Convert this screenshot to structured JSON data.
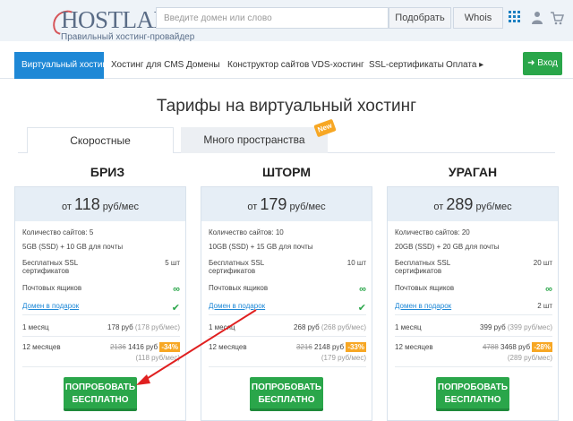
{
  "header": {
    "logo": "HOSTLAND",
    "tagline": "Правильный хостинг-провайдер",
    "search_placeholder": "Введите домен или слово",
    "find_label": "Подобрать",
    "whois_label": "Whois"
  },
  "nav": {
    "items": [
      {
        "label": "Виртуальный хостинг"
      },
      {
        "label": "Хостинг для CMS"
      },
      {
        "label": "Домены"
      },
      {
        "label": "Конструктор сайтов"
      },
      {
        "label": "VDS-хостинг"
      },
      {
        "label": "SSL-сертификаты"
      },
      {
        "label": "Оплата"
      }
    ],
    "login_label": "Вход"
  },
  "page": {
    "title": "Тарифы на виртуальный хостинг",
    "tabs": [
      {
        "label": "Скоростные"
      },
      {
        "label": "Много пространства"
      }
    ],
    "new_badge": "New"
  },
  "plans": [
    {
      "name": "БРИЗ",
      "price_prefix": "от",
      "price": "118",
      "price_unit": "руб/мес",
      "sites_label": "Количество сайтов:",
      "sites_value": "5",
      "disk": "5GB (SSD) + 10 GB для почты",
      "ssl_label": "Бесплатных SSL сертификатов",
      "ssl_value": "5 шт",
      "mail_label": "Почтовых ящиков",
      "mail_value": "∞",
      "gift_label": "Домен в подарок",
      "gift_value": "✔",
      "month_label": "1 месяц",
      "month_price": "178 руб",
      "month_note": "(178 руб/мес)",
      "year_label": "12 месяцев",
      "year_old": "2136",
      "year_price": "1416 руб",
      "year_discount": "-34%",
      "year_note": "(118 руб/мес)",
      "try_label": "ПОПРОБОВАТЬ БЕСПЛАТНО"
    },
    {
      "name": "ШТОРМ",
      "price_prefix": "от",
      "price": "179",
      "price_unit": "руб/мес",
      "sites_label": "Количество сайтов:",
      "sites_value": "10",
      "disk": "10GB (SSD) + 15 GB для почты",
      "ssl_label": "Бесплатных SSL сертификатов",
      "ssl_value": "10 шт",
      "mail_label": "Почтовых ящиков",
      "mail_value": "∞",
      "gift_label": "Домен в подарок",
      "gift_value": "✔",
      "month_label": "1 месяц",
      "month_price": "268 руб",
      "month_note": "(268 руб/мес)",
      "year_label": "12 месяцев",
      "year_old": "3216",
      "year_price": "2148 руб",
      "year_discount": "-33%",
      "year_note": "(179 руб/мес)",
      "try_label": "ПОПРОБОВАТЬ БЕСПЛАТНО"
    },
    {
      "name": "УРАГАН",
      "price_prefix": "от",
      "price": "289",
      "price_unit": "руб/мес",
      "sites_label": "Количество сайтов:",
      "sites_value": "20",
      "disk": "20GB (SSD) + 20 GB для почты",
      "ssl_label": "Бесплатных SSL сертификатов",
      "ssl_value": "20 шт",
      "mail_label": "Почтовых ящиков",
      "mail_value": "∞",
      "gift_label": "Домен в подарок",
      "gift_value": "2 шт",
      "month_label": "1 месяц",
      "month_price": "399 руб",
      "month_note": "(399 руб/мес)",
      "year_label": "12 месяцев",
      "year_old": "4788",
      "year_price": "3468 руб",
      "year_discount": "-28%",
      "year_note": "(289 руб/мес)",
      "try_label": "ПОПРОБОВАТЬ БЕСПЛАТНО"
    }
  ],
  "colors": {
    "accent": "#1e88d6",
    "green": "#2aa64a",
    "orange": "#f7a724",
    "arrow": "#e02020"
  }
}
